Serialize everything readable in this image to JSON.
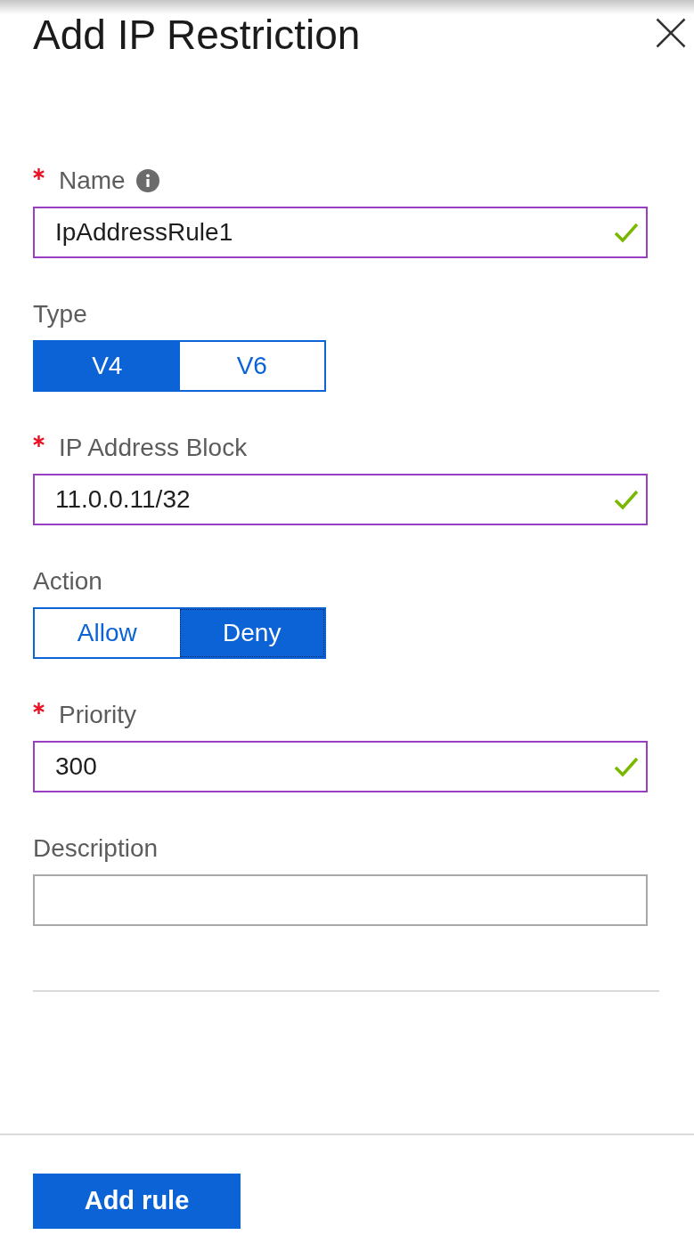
{
  "panel": {
    "title": "Add IP Restriction"
  },
  "fields": [
    {
      "kind": "text",
      "label": "Name",
      "required": true,
      "info": true,
      "value": "IpAddressRule1",
      "valid": true
    },
    {
      "kind": "toggle",
      "label": "Type",
      "required": false,
      "info": false,
      "options": [
        {
          "label": "V4",
          "selected": true,
          "focused": false
        },
        {
          "label": "V6",
          "selected": false,
          "focused": false
        }
      ]
    },
    {
      "kind": "text",
      "label": "IP Address Block",
      "required": true,
      "info": false,
      "value": "11.0.0.11/32",
      "valid": true
    },
    {
      "kind": "toggle",
      "label": "Action",
      "required": false,
      "info": false,
      "options": [
        {
          "label": "Allow",
          "selected": false,
          "focused": false
        },
        {
          "label": "Deny",
          "selected": true,
          "focused": true
        }
      ]
    },
    {
      "kind": "text",
      "label": "Priority",
      "required": true,
      "info": false,
      "value": "300",
      "valid": true
    },
    {
      "kind": "text",
      "label": "Description",
      "required": false,
      "info": false,
      "valid": false
    }
  ],
  "submit_button": {
    "label": "Add rule"
  }
}
